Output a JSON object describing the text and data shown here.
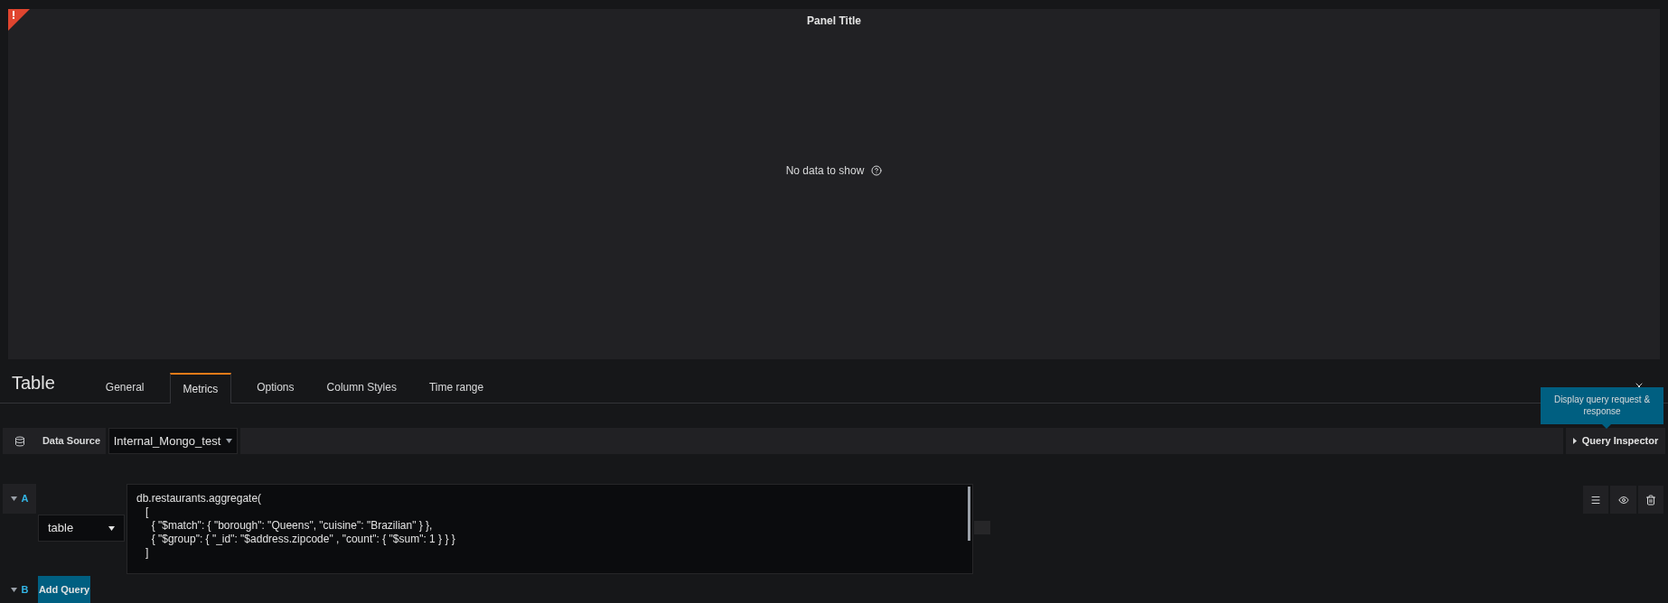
{
  "panel": {
    "title": "Panel Title",
    "alert": true,
    "message": "No data to show"
  },
  "editor": {
    "title": "Table",
    "tabs": [
      {
        "label": "General",
        "selected": false
      },
      {
        "label": "Metrics",
        "selected": true
      },
      {
        "label": "Options",
        "selected": false
      },
      {
        "label": "Column Styles",
        "selected": false
      },
      {
        "label": "Time range",
        "selected": false
      }
    ]
  },
  "datasource": {
    "label": "Data Source",
    "value": "Internal_Mongo_test",
    "inspector": "Query Inspector",
    "tooltip": "Display query request & response"
  },
  "queries": [
    {
      "ref": "A",
      "expanded": true,
      "format": "table",
      "code": [
        "db.restaurants.aggregate(",
        "   [",
        "     { \"$match\": { \"borough\": \"Queens\", \"cuisine\": \"Brazilian\" } },",
        "     { \"$group\": { \"_id\": \"$address.zipcode\" , \"count\": { \"$sum\": 1 } } }",
        "   ]"
      ]
    },
    {
      "ref": "B",
      "expanded": true
    }
  ],
  "add_query": "Add Query"
}
